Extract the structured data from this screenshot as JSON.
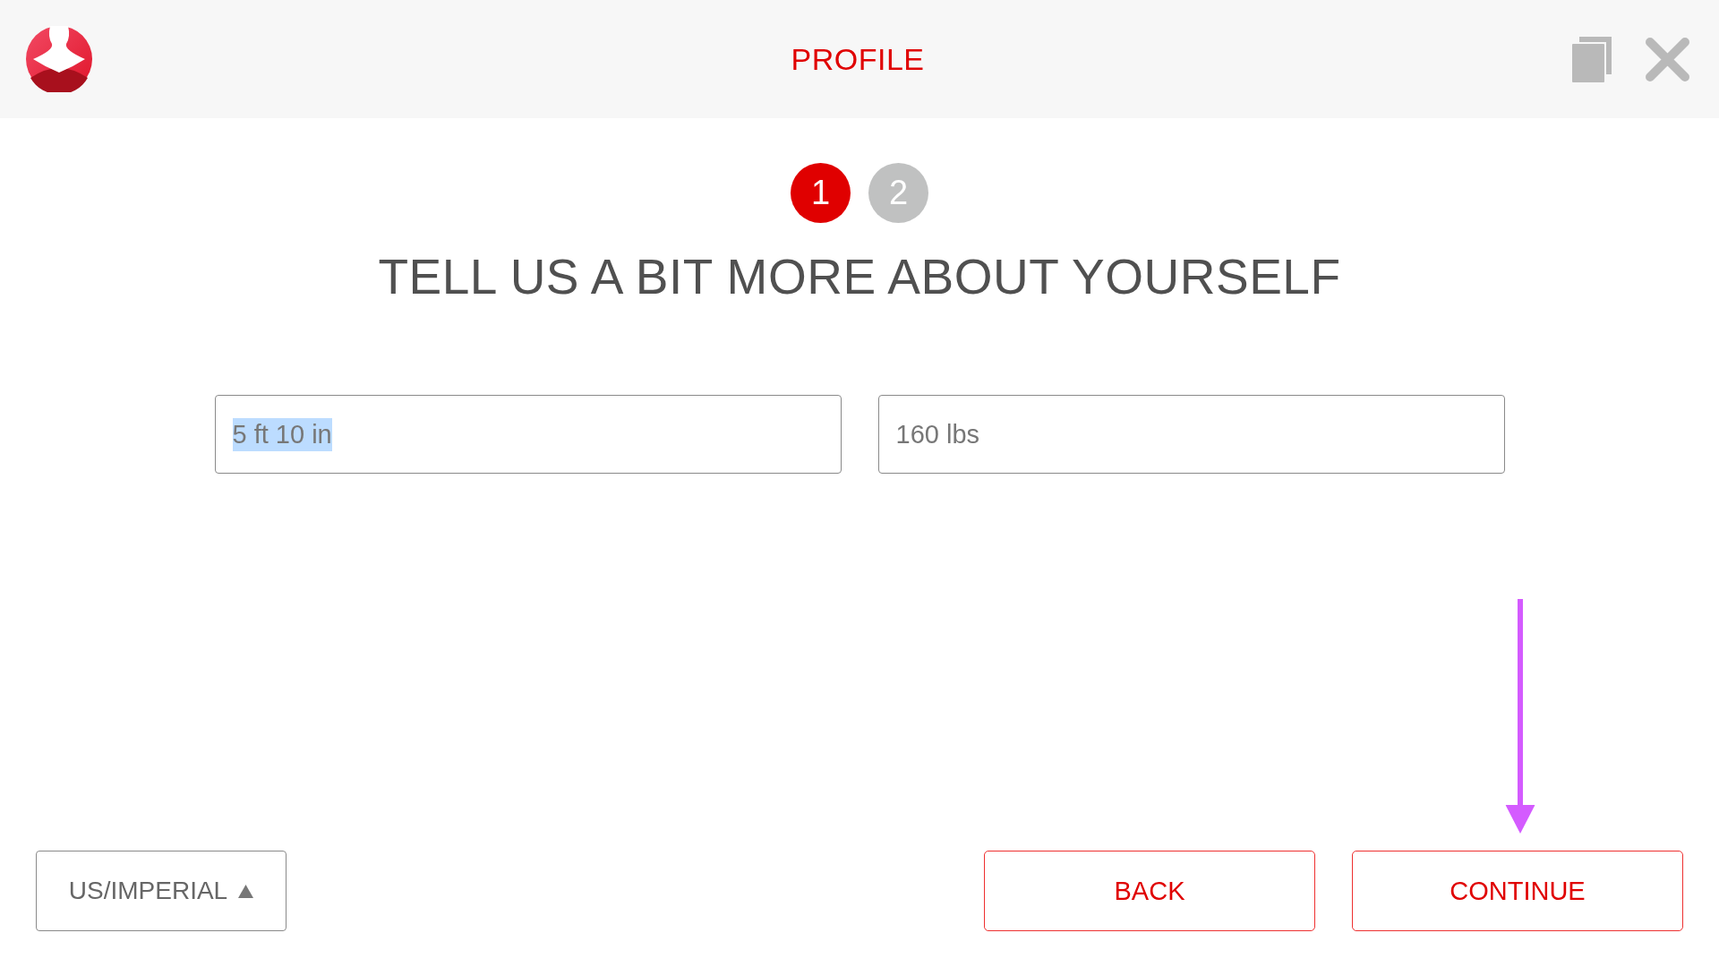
{
  "header": {
    "title": "PROFILE"
  },
  "steps": [
    {
      "label": "1",
      "selected": true
    },
    {
      "label": "2",
      "selected": false
    }
  ],
  "heading": "TELL US A BIT MORE ABOUT YOURSELF",
  "fields": [
    {
      "value": "5 ft 10 in",
      "text_selected": true
    },
    {
      "value": "160 lbs",
      "text_selected": false
    }
  ],
  "footer": {
    "unit_button": {
      "label": "US/IMPERIAL"
    },
    "buttons": [
      {
        "label": "BACK",
        "pointed_at": false
      },
      {
        "label": "CONTINUE",
        "pointed_at": true
      }
    ]
  }
}
